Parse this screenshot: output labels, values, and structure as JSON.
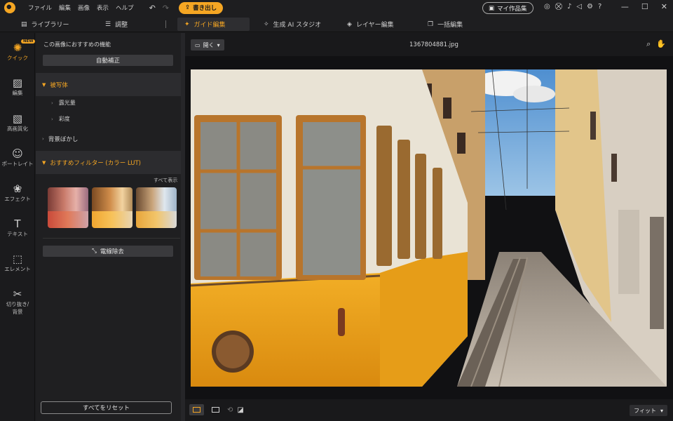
{
  "menu": [
    "ファイル",
    "編集",
    "画像",
    "表示",
    "ヘルプ"
  ],
  "toolbar": {
    "undo_icon": "undo-icon",
    "redo_icon": "redo-icon",
    "export_label": "書き出し",
    "my_works_label": "マイ作品集"
  },
  "tabs": [
    {
      "label": "ライブラリー",
      "icon": "library-icon"
    },
    {
      "label": "調整",
      "icon": "sliders-icon"
    },
    {
      "label": "ガイド編集",
      "icon": "magic-wand-icon",
      "active": true
    },
    {
      "label": "生成 AI スタジオ",
      "icon": "sparkle-icon"
    },
    {
      "label": "レイヤー編集",
      "icon": "layers-icon"
    },
    {
      "label": "一括編集",
      "icon": "batch-icon"
    }
  ],
  "rail": [
    {
      "label": "クイック",
      "badge": "NEW",
      "active": true
    },
    {
      "label": "編集"
    },
    {
      "label": "高画質化"
    },
    {
      "label": "ポートレイト"
    },
    {
      "label": "エフェクト"
    },
    {
      "label": "テキスト"
    },
    {
      "label": "エレメント"
    },
    {
      "label": "切り抜き/",
      "label2": "背景"
    }
  ],
  "panel": {
    "title": "この画像におすすめの機能",
    "auto_button": "自動補正",
    "sections": {
      "subject": "被写体",
      "exposure": "露光量",
      "saturation": "彩度",
      "bg_blur": "背景ぼかし",
      "filter": "おすすめフィルター (カラー LUT)"
    },
    "show_all": "すべて表示",
    "wire_button": "電線除去",
    "reset_button": "すべてをリセット"
  },
  "canvas": {
    "open_label": "開く",
    "filename": "1367804881.jpg",
    "fit_label": "フィット"
  },
  "colors": {
    "accent": "#f5a623",
    "panel": "#1f1f21",
    "background": "#111113"
  }
}
